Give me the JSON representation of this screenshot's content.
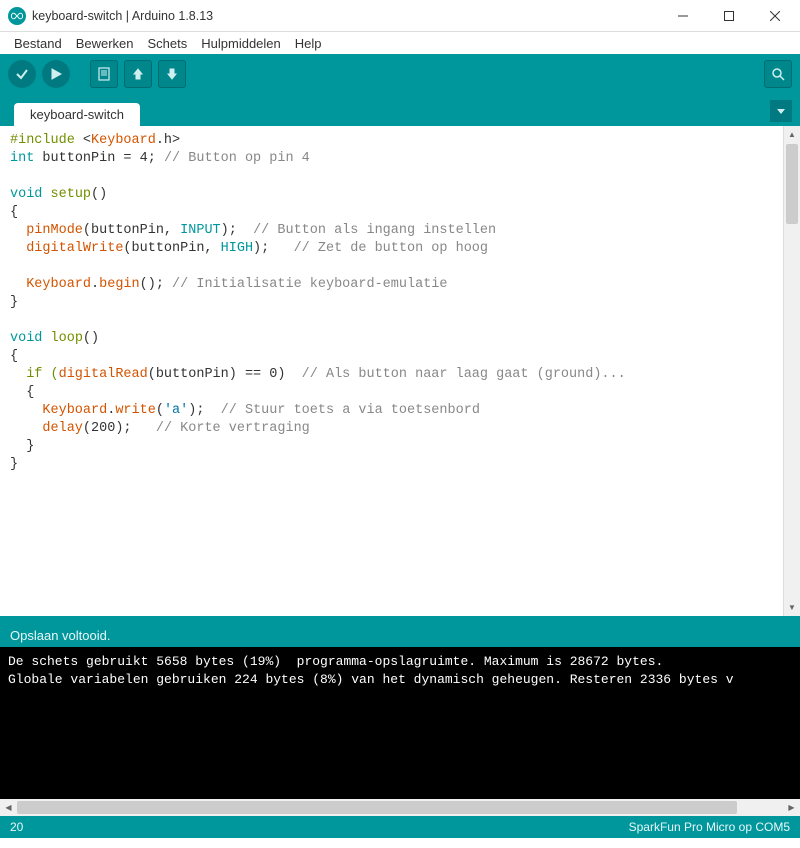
{
  "window": {
    "title": "keyboard-switch | Arduino 1.8.13"
  },
  "menubar": {
    "items": [
      "Bestand",
      "Bewerken",
      "Schets",
      "Hulpmiddelen",
      "Help"
    ]
  },
  "tabs": {
    "active": "keyboard-switch"
  },
  "code": {
    "l1_a": "#include",
    "l1_b": " <",
    "l1_c": "Keyboard",
    "l1_d": ".h>",
    "l2_a": "int",
    "l2_b": " buttonPin = 4; ",
    "l2_c": "// Button op pin 4",
    "l3": "",
    "l4_a": "void",
    "l4_b": " ",
    "l4_c": "setup",
    "l4_d": "()",
    "l5": "{",
    "l6_a": "  ",
    "l6_b": "pinMode",
    "l6_c": "(buttonPin, ",
    "l6_d": "INPUT",
    "l6_e": ");  ",
    "l6_f": "// Button als ingang instellen",
    "l7_a": "  ",
    "l7_b": "digitalWrite",
    "l7_c": "(buttonPin, ",
    "l7_d": "HIGH",
    "l7_e": ");   ",
    "l7_f": "// Zet de button op hoog",
    "l8": "",
    "l9_a": "  ",
    "l9_b": "Keyboard",
    "l9_c": ".",
    "l9_d": "begin",
    "l9_e": "(); ",
    "l9_f": "// Initialisatie keyboard-emulatie",
    "l10": "}",
    "l11": "",
    "l12_a": "void",
    "l12_b": " ",
    "l12_c": "loop",
    "l12_d": "()",
    "l13": "{",
    "l14_a": "  if (",
    "l14_b": "digitalRead",
    "l14_c": "(buttonPin) == 0)  ",
    "l14_d": "// Als button naar laag gaat (ground)...",
    "l15": "  {",
    "l16_a": "    ",
    "l16_b": "Keyboard",
    "l16_c": ".",
    "l16_d": "write",
    "l16_e": "(",
    "l16_f": "'a'",
    "l16_g": ");  ",
    "l16_h": "// Stuur toets a via toetsenbord",
    "l17_a": "    ",
    "l17_b": "delay",
    "l17_c": "(200);   ",
    "l17_d": "// Korte vertraging",
    "l18": "  }",
    "l19": "}"
  },
  "status": {
    "message": "Opslaan voltooid."
  },
  "console": {
    "line1": "De schets gebruikt 5658 bytes (19%)  programma-opslagruimte. Maximum is 28672 bytes.",
    "line2": "Globale variabelen gebruiken 224 bytes (8%) van het dynamisch geheugen. Resteren 2336 bytes v"
  },
  "footer": {
    "line": "20",
    "board": "SparkFun Pro Micro op COM5"
  }
}
